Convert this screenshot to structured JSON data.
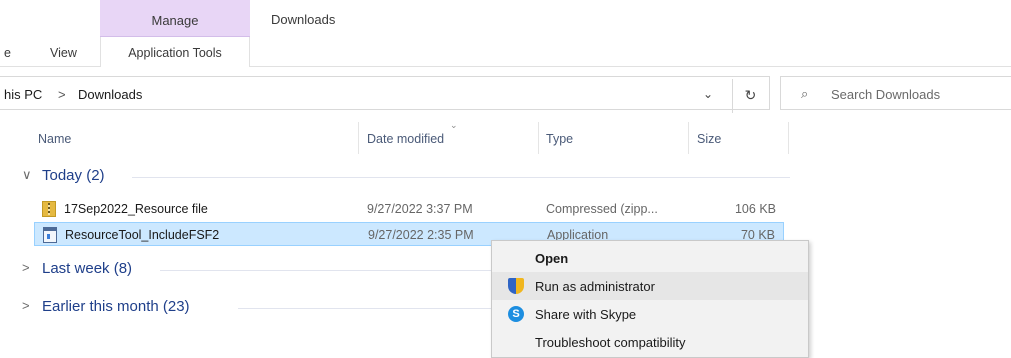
{
  "ribbon": {
    "context_tab": "Manage",
    "window_title": "Downloads",
    "tabs": [
      "e",
      "View"
    ],
    "context_subtab": "Application Tools"
  },
  "address": {
    "crumbs": [
      "his PC",
      ">",
      "Downloads"
    ],
    "dropdown_glyph": "⌄",
    "refresh_glyph": "↻"
  },
  "search": {
    "icon_glyph": "⌕",
    "placeholder": "Search Downloads"
  },
  "columns": {
    "name": "Name",
    "date": "Date modified",
    "type": "Type",
    "size": "Size",
    "sort_glyph": "⌄"
  },
  "groups": [
    {
      "chevron": "∨",
      "label": "Today (2)"
    },
    {
      "chevron": ">",
      "label": "Last week (8)"
    },
    {
      "chevron": ">",
      "label": "Earlier this month (23)"
    }
  ],
  "files": [
    {
      "name": "17Sep2022_Resource file",
      "date": "9/27/2022 3:37 PM",
      "type": "Compressed (zipp...",
      "size": "106 KB",
      "icon": "zip-folder-icon"
    },
    {
      "name": "ResourceTool_IncludeFSF2",
      "date": "9/27/2022 2:35 PM",
      "type": "Application",
      "size": "70 KB",
      "icon": "application-icon",
      "selected": true
    }
  ],
  "context_menu": {
    "items": [
      {
        "label": "Open",
        "icon": ""
      },
      {
        "label": "Run as administrator",
        "icon": "shield-icon"
      },
      {
        "label": "Share with Skype",
        "icon": "skype-icon",
        "glyph": "S"
      },
      {
        "label": "Troubleshoot compatibility",
        "icon": ""
      }
    ]
  },
  "colors": {
    "manage_tab_bg": "#e8d6f6",
    "group_label": "#1f3f8a",
    "selection_bg": "#cce8ff",
    "menu_bg": "#f2f2f2"
  }
}
